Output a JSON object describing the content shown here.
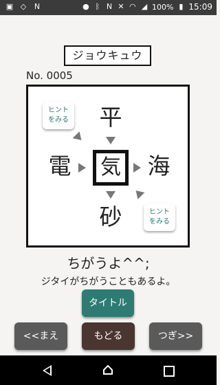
{
  "status_bar": {
    "battery": "100%",
    "time": "15:09",
    "icons_left": [
      "app-icon",
      "shield-icon",
      "n-icon"
    ],
    "icons_right": [
      "location-icon",
      "bluetooth-icon",
      "nfc-icon",
      "mute-icon",
      "wifi-icon",
      "signal-icon",
      "battery-icon"
    ]
  },
  "level": {
    "title": "ジョウキュウ",
    "number": "No. 0005"
  },
  "puzzle": {
    "top": "平",
    "left": "電",
    "right": "海",
    "bottom": "砂",
    "center": "気"
  },
  "hint": {
    "line1": "ヒント",
    "line2": "をみる"
  },
  "message": {
    "main": "ちがうよ^^;",
    "sub": "ジタイがちがうこともあるよ。"
  },
  "buttons": {
    "title": "タイトル",
    "prev": "<<まえ",
    "back": "もどる",
    "next": "つぎ>>"
  },
  "colors": {
    "teal": "#2e7b74",
    "gray_button": "#5a5a5a",
    "brown_button": "#4a3531"
  }
}
